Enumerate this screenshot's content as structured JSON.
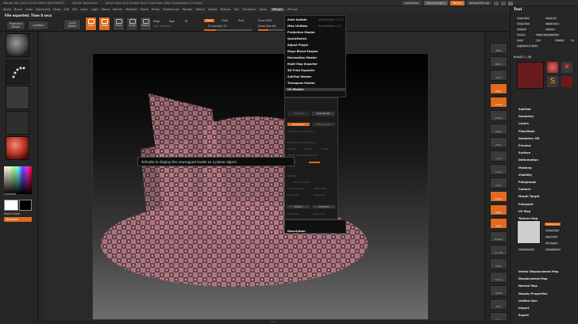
{
  "titlebar": {
    "app": "ZBrush 4R7 [2015 2016 OVER 1463 P4MTE]",
    "document": "ZBrush Document",
    "stats": "Active Mem 414  Scratch Disk 4  Free Mem 3645  QuickSave In 19 Secs",
    "quicksave": "QuickSave",
    "seethrough": "See-through  0",
    "menus_label": "Menus",
    "script": "DefaultZScript"
  },
  "menubar": [
    "Alpha",
    "Brush",
    "Color",
    "Document",
    "Draw",
    "Edit",
    "File",
    "Layer",
    "Light",
    "Macro",
    "Marker",
    "Material",
    "Movie",
    "Picker",
    "Preferences",
    "Render",
    "Stencil",
    "Stroke",
    "Texture",
    "Tool",
    "Transform",
    "Zoom",
    "ZPlugin",
    "ZScript"
  ],
  "menubar_active": "ZPlugin",
  "status": {
    "line1": "File exported. Time 8 secs"
  },
  "toolbar": {
    "projection_master": "Projection Master",
    "lightbox": "LightBox",
    "quick_sketch": "Quick Sketch",
    "edit": "Edit",
    "draw": "Draw",
    "move": "Move",
    "scale": "Scale",
    "rotate": "Rotate",
    "mrgb": "Mrgb",
    "rgb": "Rgb",
    "m": "M",
    "rgb_intensity": "Rgb Intensity",
    "zadd": "Zadd",
    "zsub": "Zsub",
    "zcut": "Zcut",
    "z_intensity": "Z Intensity 25",
    "z_intensity_value": 0.25,
    "focal_shift": "Focal Shift",
    "draw_size": "Draw Size 64",
    "draw_size_value": 0.4
  },
  "left_shelf": {
    "gradient": "Gradient",
    "switch_color": "SwitchColor",
    "alternate": "Alternate"
  },
  "zplugin_menu": {
    "items": [
      "Auto Update",
      "Misc Utilities",
      "Projection Master",
      "QuickSketch",
      "Adjust Plugin",
      "Maya Blend Shapes",
      "Decimation Master",
      "Multi Map Exporter",
      "3D Print Exporter",
      "SubTool Master",
      "Transpose Master",
      "UV Master"
    ],
    "auto_update_value": "ActivePlugin 1.0.0",
    "misc_value": "ZoneDAudio 1.0"
  },
  "uv_master": {
    "unwrap": "Unwrap",
    "unwrap_all": "Unwrap All",
    "symmetry": "Symmetry",
    "polygroups": "Polygroups",
    "use_existing": "Use Existing UV Seams",
    "enable_control_painting": "Enable Control Painting",
    "protect": "Protect",
    "attract": "Attract",
    "erase": "Erase",
    "attract_ambient": "Attract from Ambient Occ",
    "density": "Density",
    "utilities": "Utilities",
    "work_on_clone": "Work On Clone",
    "flatten": "Flatten",
    "unflatten": "UnFlatten",
    "check_seams": "Check Seams",
    "clear_maps": "Clear Maps",
    "copy_uvs": "Copy UVs",
    "paste_uvs": "Paste UVs",
    "load_uvs": "Load UVs",
    "save_uvs": "Save UVs"
  },
  "description": "Description",
  "tooltip": "Activate to display the unwrapped model as a planar object.",
  "right_shelf": [
    "BPR",
    "SPix 3",
    "Scroll",
    "Zoom",
    "Actual",
    "AAHalf",
    "Persp",
    "Floor",
    "Local",
    "L.Sym",
    "Gxyz",
    "Frame",
    "Move",
    "Scale",
    "Rotate",
    "Line Fill",
    "PolyF",
    "Transp",
    "Ghost",
    "Solo",
    "Xpose"
  ],
  "tool_tray": {
    "title": "Tool",
    "buttons": [
      "Load Tool",
      "Save As",
      "Copy Tool",
      "Paste Tool",
      "Import",
      "Export",
      "Clone",
      "Make PolyMesh3D",
      "GoZ",
      "All",
      "Visible",
      "R",
      "Lightbox > Tools"
    ],
    "current_tool": "Bust02-1_48",
    "tool_thumbs": [
      "Cylinder3D",
      "PolyMesh3D",
      "SimpleBrush",
      "Bust02-1_48"
    ],
    "sections": [
      "SubTool",
      "Geometry",
      "Layers",
      "FiberMesh",
      "Geometry HD",
      "Preview",
      "Surface",
      "Deformation",
      "Masking",
      "Visibility",
      "Polygroups",
      "Contact",
      "Morph Target",
      "Polypaint",
      "UV Map",
      "Texture Map"
    ],
    "texture_buttons": [
      "Texture On",
      "Clone Txtr",
      "New Txtr",
      "Fix Seam",
      "Transparent",
      "Antialiased"
    ],
    "after": [
      "Vector Displacement Map",
      "Displacement Map",
      "Normal Map",
      "Display Properties",
      "Unified Skin",
      "Import",
      "Export"
    ],
    "texture_on_label": "Txtr"
  },
  "bottom": "0 / 7"
}
